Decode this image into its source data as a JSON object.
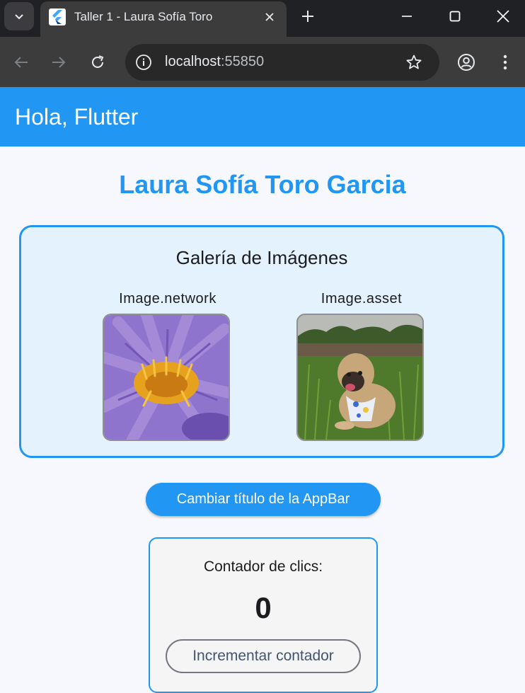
{
  "browser": {
    "tab_title": "Taller 1 - Laura Sofía Toro",
    "url_host": "localhost",
    "url_port": ":55850",
    "icons": {
      "tab_search": "chevron-down-icon",
      "favicon": "flutter-icon",
      "tab_close": "close-icon",
      "new_tab": "plus-icon",
      "minimize": "minimize-icon",
      "maximize": "maximize-icon",
      "close_window": "close-icon",
      "back": "arrow-left-icon",
      "forward": "arrow-right-icon",
      "reload": "reload-icon",
      "site_info": "info-icon",
      "bookmark": "star-icon",
      "profile": "account-icon",
      "menu": "more-vertical-icon"
    }
  },
  "app": {
    "appbar_title": "Hola, Flutter",
    "heading": "Laura Sofía Toro Garcia",
    "gallery": {
      "title": "Galería de Imágenes",
      "items": [
        {
          "label": "Image.network"
        },
        {
          "label": "Image.asset"
        }
      ]
    },
    "change_title_button": "Cambiar título de la AppBar",
    "counter": {
      "label": "Contador de clics:",
      "value": "0",
      "increment_button": "Incrementar contador"
    }
  },
  "colors": {
    "primary": "#2196f3",
    "primary_light": "#e3f2fd",
    "chrome_dark": "#202124",
    "chrome_toolbar": "#3c3c3c"
  }
}
